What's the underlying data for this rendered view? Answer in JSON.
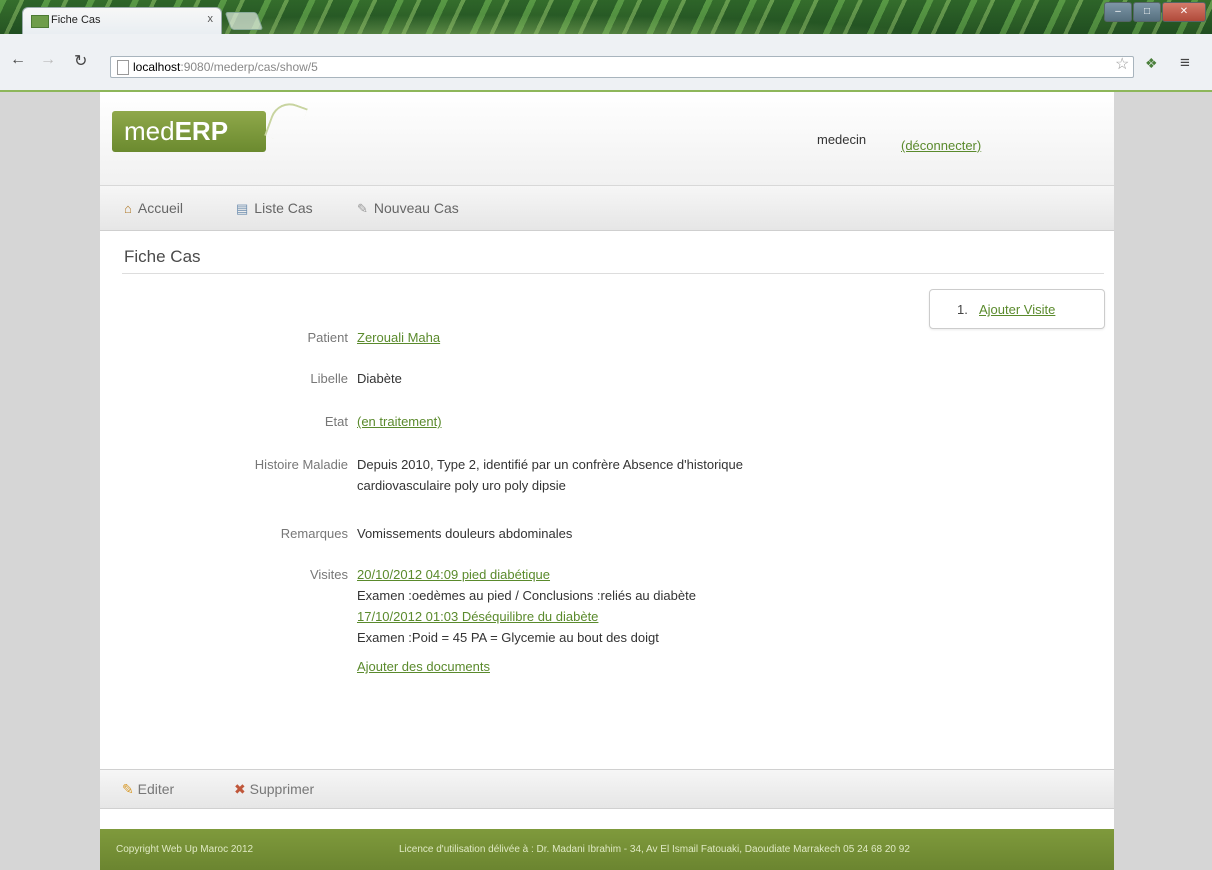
{
  "browser": {
    "tab_title": "Fiche Cas",
    "tab_close": "x",
    "url_host": "localhost",
    "url_path": ":9080/mederp/cas/show/5",
    "icons": [
      "back-icon",
      "forward-icon",
      "reload-icon",
      "page-icon",
      "star-icon",
      "extension-icon",
      "menu-icon"
    ]
  },
  "header": {
    "logo_light": "med",
    "logo_bold": "ERP",
    "user": "medecin",
    "logout": "(déconnecter)"
  },
  "nav": {
    "items": [
      {
        "label": "Accueil",
        "icon": "home-icon"
      },
      {
        "label": "Liste Cas",
        "icon": "list-icon"
      },
      {
        "label": "Nouveau Cas",
        "icon": "new-document-icon"
      }
    ]
  },
  "page": {
    "title": "Fiche Cas",
    "action": {
      "number": "1.",
      "label": "Ajouter Visite"
    }
  },
  "fields": {
    "patient": {
      "label": "Patient",
      "value": "Zerouali Maha"
    },
    "libelle": {
      "label": "Libelle",
      "value": "Diabète"
    },
    "etat": {
      "label": "Etat",
      "value": "(en traitement)"
    },
    "histoire": {
      "label": "Histoire Maladie",
      "line1": "Depuis 2010, Type 2, identifié par un confrère Absence d'historique",
      "line2": "cardiovasculaire poly uro poly dipsie"
    },
    "remarques": {
      "label": "Remarques",
      "value": "Vomissements douleurs abdominales"
    },
    "visites": {
      "label": "Visites",
      "items": [
        {
          "link": "20/10/2012 04:09 pied diabétique",
          "detail": "Examen :oedèmes au pied / Conclusions :reliés au diabète"
        },
        {
          "link": "17/10/2012 01:03 Déséquilibre du diabète",
          "detail": "Examen :Poid = 45 PA = Glycemie au bout des doigt"
        }
      ]
    },
    "add_documents": "Ajouter des documents"
  },
  "bottom_actions": [
    {
      "label": "Editer",
      "icon": "edit-icon"
    },
    {
      "label": "Supprimer",
      "icon": "delete-icon"
    }
  ],
  "footer": {
    "copyright": "Copyright Web Up Maroc 2012",
    "license": "Licence d'utilisation délivée à : Dr. Madani Ibrahim - 34, Av El Ismail Fatouaki, Daoudiate Marrakech 05 24 68 20 92"
  }
}
